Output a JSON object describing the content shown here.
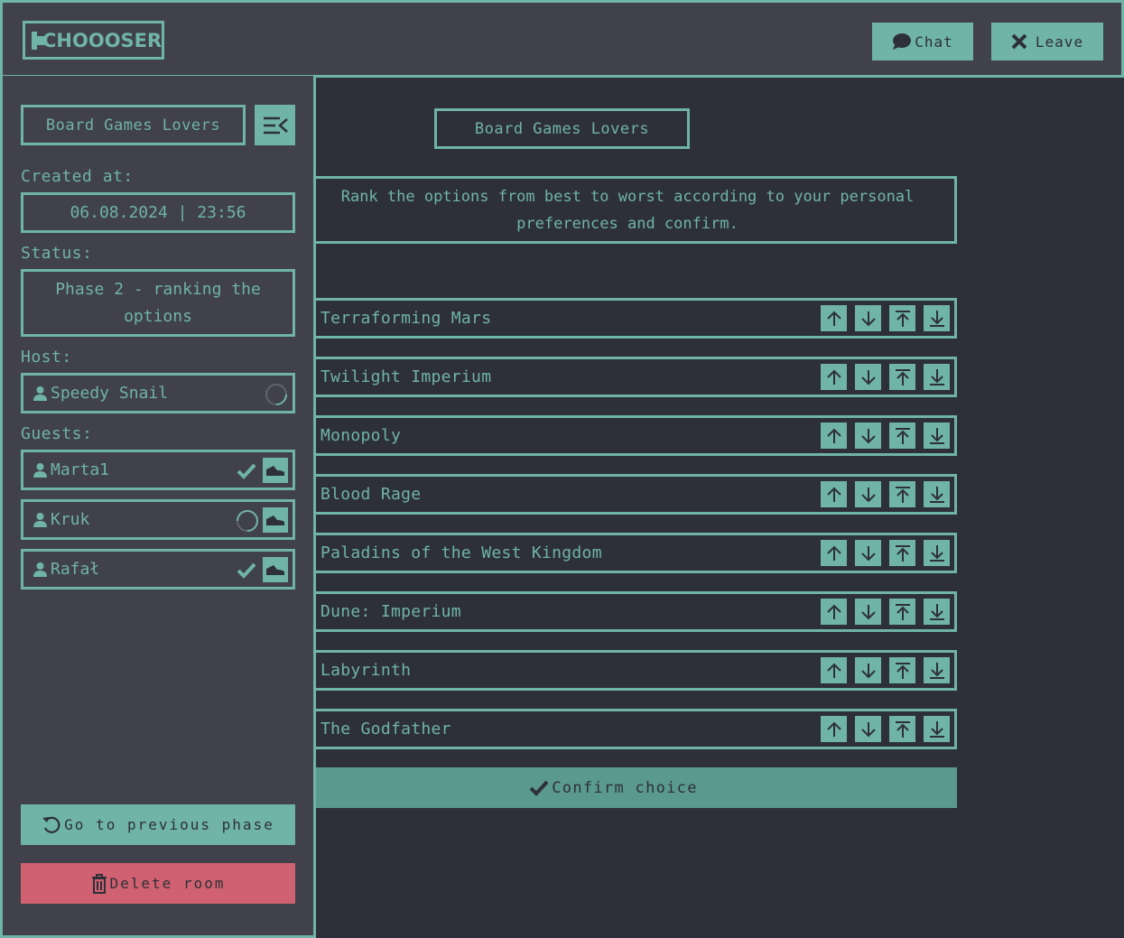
{
  "header": {
    "logo_text": "CHOOOSER",
    "chat_label": "Chat",
    "leave_label": "Leave"
  },
  "main": {
    "room_title": "Board Games Lovers",
    "instructions": "Rank the options from best to worst according to your personal preferences and confirm.",
    "options": [
      {
        "label": "Terraforming Mars"
      },
      {
        "label": "Twilight Imperium"
      },
      {
        "label": "Monopoly"
      },
      {
        "label": "Blood Rage"
      },
      {
        "label": "Paladins of the West Kingdom"
      },
      {
        "label": "Dune: Imperium"
      },
      {
        "label": "Labyrinth"
      },
      {
        "label": "The Godfather"
      }
    ],
    "confirm_label": "Confirm choice"
  },
  "sidebar": {
    "room_title": "Board Games Lovers",
    "created_label": "Created at:",
    "created_value": "06.08.2024 | 23:56",
    "status_label": "Status:",
    "status_line1": "Phase 2 - ranking the",
    "status_line2": "options",
    "host_label": "Host:",
    "host": {
      "name": "Speedy Snail",
      "status": "pending"
    },
    "guests_label": "Guests:",
    "guests": [
      {
        "name": "Marta1",
        "status": "confirmed"
      },
      {
        "name": "Kruk",
        "status": "pending"
      },
      {
        "name": "Rafał",
        "status": "confirmed"
      }
    ],
    "prev_phase_label": "Go to previous phase",
    "delete_label": "Delete room"
  },
  "colors": {
    "accent": "#6fb3a9",
    "background": "#2e3039",
    "panel": "#40414b",
    "danger": "#cf6170",
    "confirm": "#5a9990"
  }
}
